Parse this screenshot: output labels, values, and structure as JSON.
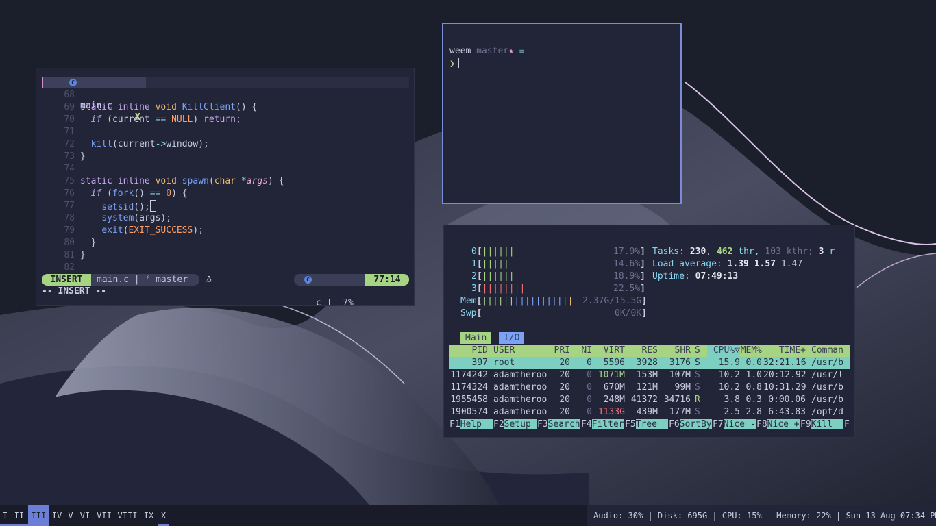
{
  "editor": {
    "tab_name": "main.c",
    "tab_close": "X",
    "lines": [
      {
        "n": "68",
        "t": ""
      },
      {
        "n": "69",
        "t": "static inline void KillClient() {"
      },
      {
        "n": "70",
        "t": "  if (current == NULL) return;"
      },
      {
        "n": "71",
        "t": ""
      },
      {
        "n": "72",
        "t": "  kill(current->window);"
      },
      {
        "n": "73",
        "t": "}"
      },
      {
        "n": "74",
        "t": ""
      },
      {
        "n": "75",
        "t": "static inline void spawn(char *args) {"
      },
      {
        "n": "76",
        "t": "  if (fork() == 0) {"
      },
      {
        "n": "77",
        "t": "    setsid();"
      },
      {
        "n": "78",
        "t": "    system(args);"
      },
      {
        "n": "79",
        "t": "    exit(EXIT_SUCCESS);"
      },
      {
        "n": "80",
        "t": "  }"
      },
      {
        "n": "81",
        "t": "}"
      },
      {
        "n": "82",
        "t": ""
      }
    ],
    "status": {
      "mode": "INSERT",
      "file": "main.c | ᚠ master",
      "filetype": "c |  7%",
      "position": "77:14"
    },
    "cmdline": "-- INSERT --"
  },
  "terminal": {
    "dir": "weem",
    "branch": "master",
    "dirty": "★",
    "stash": "≡",
    "prompt": "❯"
  },
  "htop": {
    "cpus": [
      {
        "label": "0",
        "bar": "||||||",
        "pct": "17.9%"
      },
      {
        "label": "1",
        "bar": "|||||",
        "pct": "14.6%"
      },
      {
        "label": "2",
        "bar": "||||||",
        "pct": "18.9%"
      },
      {
        "label": "3",
        "bar": "||||||||",
        "pct": "22.5%"
      }
    ],
    "mem": {
      "label": "Mem",
      "bar": "|||||||||||||||||",
      "value": "2.37G/15.5G"
    },
    "swp": {
      "label": "Swp",
      "bar": "",
      "value": "0K/0K"
    },
    "tasks": {
      "label": "Tasks:",
      "tasks": "230",
      "thr": "462",
      "thr_label": "thr,",
      "kthr": "103",
      "kthr_label": "kthr;",
      "running": "3",
      "running_label": "r"
    },
    "load": {
      "label": "Load average:",
      "l1": "1.39",
      "l5": "1.57",
      "l15": "1.47"
    },
    "uptime": {
      "label": "Uptime:",
      "value": "07:49:13"
    },
    "tabs": [
      "Main",
      "I/O"
    ],
    "columns": {
      "pid": "PID",
      "user": "USER",
      "pri": "PRI",
      "ni": "NI",
      "virt": "VIRT",
      "res": "RES",
      "shr": "SHR",
      "s": "S",
      "cpu": "CPU%▽",
      "mem": "MEM%",
      "time": "TIME+",
      "cmd": "Comman"
    },
    "rows": [
      {
        "pid": "397",
        "user": "root",
        "pri": "20",
        "ni": "0",
        "virt": "5596",
        "res": "3928",
        "shr": "3176",
        "s": "S",
        "cpu": "15.9",
        "mem": "0.0",
        "time": "32:21.16",
        "cmd": "/usr/b"
      },
      {
        "pid": "1174242",
        "user": "adamtheroo",
        "pri": "20",
        "ni": "0",
        "virt": "1071M",
        "res": "153M",
        "shr": "107M",
        "s": "S",
        "cpu": "10.2",
        "mem": "1.0",
        "time": "20:12.92",
        "cmd": "/usr/l"
      },
      {
        "pid": "1174324",
        "user": "adamtheroo",
        "pri": "20",
        "ni": "0",
        "virt": "670M",
        "res": "121M",
        "shr": "99M",
        "s": "S",
        "cpu": "10.2",
        "mem": "0.8",
        "time": "10:31.29",
        "cmd": "/usr/b"
      },
      {
        "pid": "1955458",
        "user": "adamtheroo",
        "pri": "20",
        "ni": "0",
        "virt": "248M",
        "res": "41372",
        "shr": "34716",
        "s": "R",
        "cpu": "3.8",
        "mem": "0.3",
        "time": "0:00.06",
        "cmd": "/usr/b"
      },
      {
        "pid": "1900574",
        "user": "adamtheroo",
        "pri": "20",
        "ni": "0",
        "virt": "1133G",
        "res": "439M",
        "shr": "177M",
        "s": "S",
        "cpu": "2.5",
        "mem": "2.8",
        "time": "6:43.83",
        "cmd": "/opt/d"
      }
    ],
    "fkeys": [
      {
        "key": "F1",
        "label": "Help  "
      },
      {
        "key": "F2",
        "label": "Setup "
      },
      {
        "key": "F3",
        "label": "Search"
      },
      {
        "key": "F4",
        "label": "Filter"
      },
      {
        "key": "F5",
        "label": "Tree  "
      },
      {
        "key": "F6",
        "label": "SortBy"
      },
      {
        "key": "F7",
        "label": "Nice -"
      },
      {
        "key": "F8",
        "label": "Nice +"
      },
      {
        "key": "F9",
        "label": "Kill  "
      },
      {
        "key": "F",
        "label": ""
      }
    ]
  },
  "bar": {
    "workspaces": [
      "I",
      "II",
      "III",
      "IV",
      "V",
      "VI",
      "VII",
      "VIII",
      "IX",
      "X"
    ],
    "active_workspace": "III",
    "status": "Audio: 30% | Disk: 695G | CPU: 15% | Memory: 22% | Sun 13 Aug 07:34 PM"
  },
  "colors": {
    "accent": "#6c7fd6",
    "green": "#a7d482",
    "teal": "#7dcfc2",
    "pink": "#d58ec8",
    "background": "#1b1e2b"
  }
}
